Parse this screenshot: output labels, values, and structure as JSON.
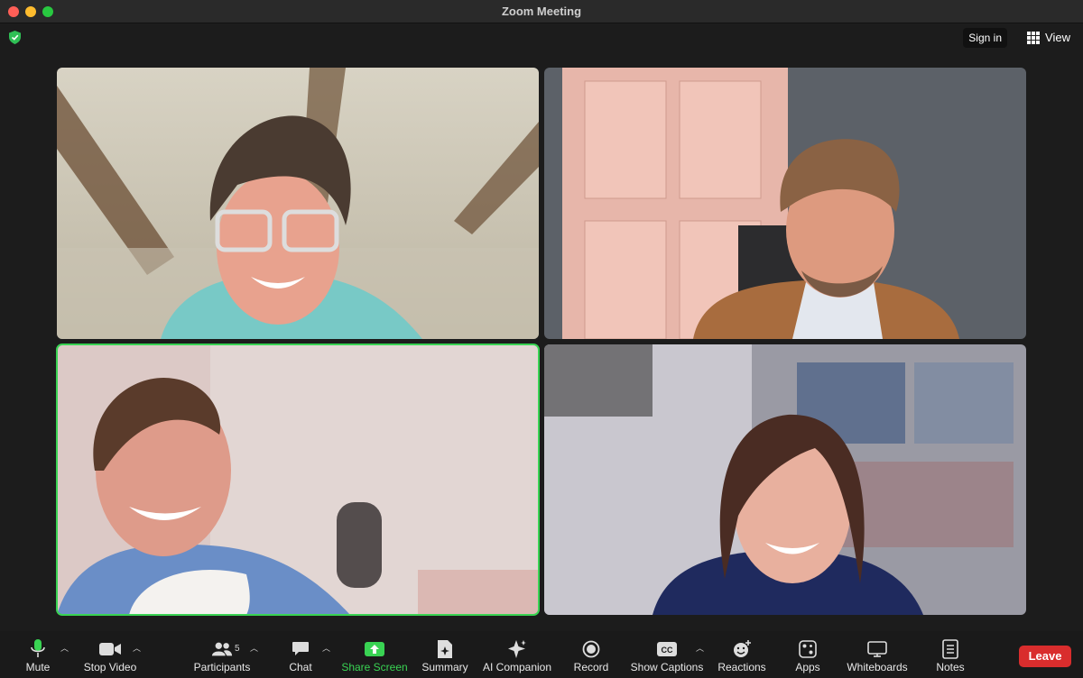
{
  "window": {
    "title": "Zoom Meeting"
  },
  "header": {
    "sign_in": "Sign in",
    "view": "View"
  },
  "toolbar": {
    "mute": "Mute",
    "stop_video": "Stop Video",
    "participants": "Participants",
    "participants_count": "5",
    "chat": "Chat",
    "share_screen": "Share Screen",
    "summary": "Summary",
    "ai_companion": "AI Companion",
    "record": "Record",
    "show_captions": "Show Captions",
    "reactions": "Reactions",
    "apps": "Apps",
    "whiteboards": "Whiteboards",
    "notes": "Notes",
    "leave": "Leave"
  },
  "colors": {
    "active_speaker": "#39d353",
    "leave": "#d92d2d",
    "share": "#39d353"
  }
}
